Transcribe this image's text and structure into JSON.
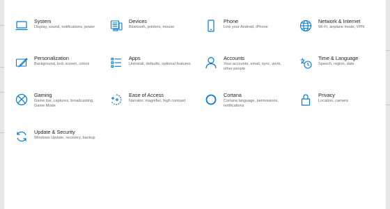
{
  "accent_color": "#0078d7",
  "tiles": [
    {
      "icon": "laptop-icon",
      "title": "System",
      "desc": "Display, sound, notifications, power"
    },
    {
      "icon": "devices-icon",
      "title": "Devices",
      "desc": "Bluetooth, printers, mouse"
    },
    {
      "icon": "phone-icon",
      "title": "Phone",
      "desc": "Link your Android, iPhone"
    },
    {
      "icon": "globe-icon",
      "title": "Network & Internet",
      "desc": "Wi-Fi, airplane mode, VPN"
    },
    {
      "icon": "paint-icon",
      "title": "Personalization",
      "desc": "Background, lock screen, colors"
    },
    {
      "icon": "apps-icon",
      "title": "Apps",
      "desc": "Uninstall, defaults, optional features"
    },
    {
      "icon": "person-icon",
      "title": "Accounts",
      "desc": "Your accounts, email, sync, work, other people"
    },
    {
      "icon": "time-language-icon",
      "title": "Time & Language",
      "desc": "Speech, region, date"
    },
    {
      "icon": "xbox-icon",
      "title": "Gaming",
      "desc": "Game bar, captures, broadcasting, Game Mode"
    },
    {
      "icon": "ease-of-access-icon",
      "title": "Ease of Access",
      "desc": "Narrator, magnifier, high contrast"
    },
    {
      "icon": "cortana-icon",
      "title": "Cortana",
      "desc": "Cortana language, permissions, notifications"
    },
    {
      "icon": "lock-icon",
      "title": "Privacy",
      "desc": "Location, camera"
    },
    {
      "icon": "sync-icon",
      "title": "Update & Security",
      "desc": "Windows Update, recovery, backup"
    }
  ]
}
